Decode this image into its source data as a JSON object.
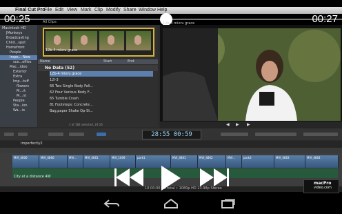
{
  "player": {
    "time_elapsed": "00:25",
    "time_remaining": "00:27"
  },
  "menubar": {
    "app_name": "Final Cut Pro",
    "items": [
      "File",
      "Edit",
      "View",
      "Mark",
      "Clip",
      "Modify",
      "Share",
      "Window",
      "Help"
    ]
  },
  "sidebar": {
    "items": [
      "Macintosh HD",
      "JMonkeys",
      "Broadcasting",
      "Child...spot",
      "Homefront",
      "People",
      "Impe... New",
      "sce...ofiles",
      "Mac...ideo",
      "Exterior",
      "Extra",
      "Imp...tuff",
      "flowers",
      "M...rt",
      "M...nt",
      "People",
      "Sta...ion",
      "Wa...io"
    ]
  },
  "browser": {
    "header": "All Clips",
    "clip_label": "12b-4 mixru grace",
    "columns": [
      "Name",
      "Start",
      "End"
    ],
    "group_label": "No Data (52)",
    "rows": [
      "12b-4 mixru grace",
      "12l-3",
      "66 Two Single Body Fall...",
      "62 Four Various Body F...",
      "65 Tumble Crash",
      "81 Footsteps: Concrete...",
      "Bag,paper Shake Op-St..."
    ],
    "selection_status": "1 of 182 selected, 24:16"
  },
  "viewer": {
    "title": "12b-4 mixru grace"
  },
  "timecode": "28:55 00:59",
  "timeline": {
    "project_name": "Imperfectly2",
    "clips": [
      "MVI_4000",
      "MVI_4860",
      "MVI...",
      "MVI_4661",
      "MVI_1009",
      "park1",
      "MVI_4861",
      "MVI_4862",
      "MVI...",
      "park3",
      "MVI_4863",
      "MVI_4864"
    ],
    "audio_label": "City at a distance 4W",
    "status": "10:00:00:25 total • 1080p HD 23.98p Stereo"
  },
  "branding": {
    "logo_line1": "macPro",
    "logo_line2": "video.com"
  },
  "icons": [
    "rewind-icon",
    "play-icon",
    "fast-forward-icon",
    "back-icon",
    "home-icon",
    "recent-apps-icon"
  ],
  "colors": {
    "selection_border": "#d6b53a",
    "timeline_clip": "#4a6f98",
    "audio_track": "#275a3c",
    "timecode_text": "#9fd3f4"
  }
}
